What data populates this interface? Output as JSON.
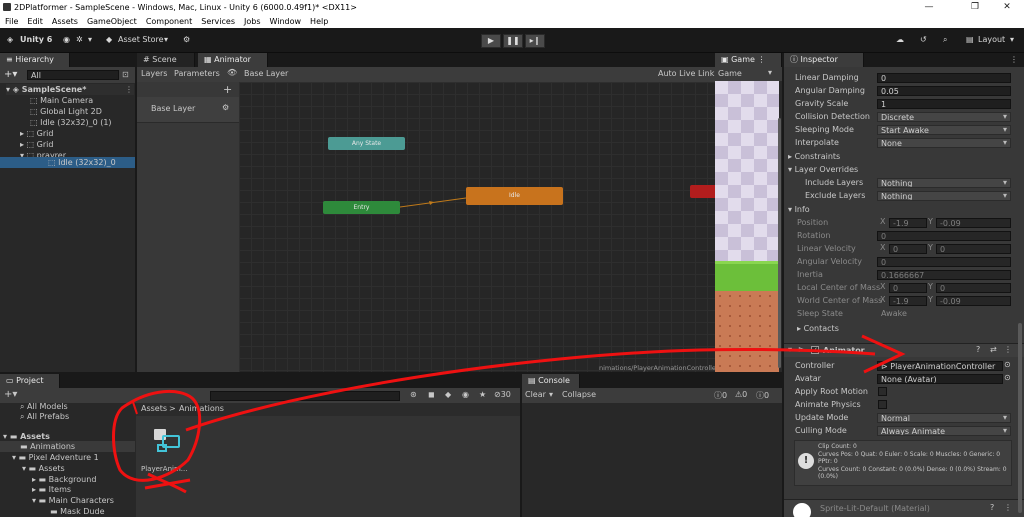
{
  "window": {
    "title": "2DPlatformer - SampleScene - Windows, Mac, Linux - Unity 6 (6000.0.49f1)* <DX11>",
    "minimize": "—",
    "maximize": "❐",
    "close": "✕"
  },
  "menu": [
    "File",
    "Edit",
    "Assets",
    "GameObject",
    "Component",
    "Services",
    "Jobs",
    "Window",
    "Help"
  ],
  "toolbar": {
    "unity_label": "Unity 6",
    "asset_store": "Asset Store",
    "layout": "Layout"
  },
  "hierarchy": {
    "tab": "Hierarchy",
    "search_placeholder": "All",
    "items": [
      {
        "label": "SampleScene*"
      },
      {
        "label": "Main Camera"
      },
      {
        "label": "Global Light 2D"
      },
      {
        "label": "Idle (32x32)_0 (1)"
      },
      {
        "label": "Grid"
      },
      {
        "label": "Grid"
      },
      {
        "label": "prayrer"
      },
      {
        "label": "Idle (32x32)_0"
      }
    ]
  },
  "animator": {
    "tabs": {
      "scene": "Scene",
      "animator": "Animator",
      "game": "Game"
    },
    "layers_tab": "Layers",
    "parameters_tab": "Parameters",
    "breadcrumb": "Base Layer",
    "auto_live_link": "Auto Live Link",
    "base_layer": "Base Layer",
    "nodes": {
      "any_state": "Any State",
      "entry": "Entry",
      "idle": "Idle"
    },
    "footer_path": "nimations/PlayerAnimationController.controller",
    "game_dropdown": "Game"
  },
  "inspector": {
    "tab": "Inspector",
    "rows": [
      {
        "label": "Linear Damping",
        "value": "0"
      },
      {
        "label": "Angular Damping",
        "value": "0.05"
      },
      {
        "label": "Gravity Scale",
        "value": "1"
      },
      {
        "label": "Collision Detection",
        "value": "Discrete"
      },
      {
        "label": "Sleeping Mode",
        "value": "Start Awake"
      },
      {
        "label": "Interpolate",
        "value": "None"
      }
    ],
    "constraints": "Constraints",
    "layer_overrides": "Layer Overrides",
    "include_layers": {
      "label": "Include Layers",
      "value": "Nothing"
    },
    "exclude_layers": {
      "label": "Exclude Layers",
      "value": "Nothing"
    },
    "info": "Info",
    "info_rows": {
      "position": {
        "label": "Position",
        "x": "-1.9",
        "y": "-0.09"
      },
      "rotation": {
        "label": "Rotation",
        "value": "0"
      },
      "linear_velocity": {
        "label": "Linear Velocity",
        "x": "0",
        "y": "0"
      },
      "angular_velocity": {
        "label": "Angular Velocity",
        "value": "0"
      },
      "inertia": {
        "label": "Inertia",
        "value": "0.1666667"
      },
      "local_com": {
        "label": "Local Center of Mass",
        "x": "0",
        "y": "0"
      },
      "world_com": {
        "label": "World Center of Mass",
        "x": "-1.9",
        "y": "-0.09"
      },
      "sleep_state": {
        "label": "Sleep State",
        "value": "Awake"
      }
    },
    "contacts": "Contacts",
    "animator_component": "Animator",
    "controller": {
      "label": "Controller",
      "value": "PlayerAnimationController"
    },
    "avatar": {
      "label": "Avatar",
      "value": "None (Avatar)"
    },
    "apply_root_motion": "Apply Root Motion",
    "animate_physics": "Animate Physics",
    "update_mode": {
      "label": "Update Mode",
      "value": "Normal"
    },
    "culling_mode": {
      "label": "Culling Mode",
      "value": "Always Animate"
    },
    "info_box": "Clip Count: 0\nCurves Pos: 0 Quat: 0 Euler: 0 Scale: 0 Muscles: 0 Generic: 0 PPtr: 0\nCurves Count: 0 Constant: 0 (0.0%) Dense: 0 (0.0%) Stream: 0 (0.0%)",
    "material": "Sprite-Lit-Default (Material)",
    "x_label": "X",
    "y_label": "Y"
  },
  "project": {
    "tab": "Project",
    "count": "30",
    "breadcrumb_root": "Assets",
    "breadcrumb_sep": ">",
    "breadcrumb_child": "Animations",
    "tree": [
      {
        "label": "All Models"
      },
      {
        "label": "All Prefabs"
      },
      {
        "label": "Assets"
      },
      {
        "label": "Animations"
      },
      {
        "label": "Pixel Adventure 1"
      },
      {
        "label": "Assets"
      },
      {
        "label": "Background"
      },
      {
        "label": "Items"
      },
      {
        "label": "Main Characters"
      },
      {
        "label": "Mask Dude"
      }
    ],
    "asset_label": "PlayerAnim..."
  },
  "console": {
    "tab": "Console",
    "clear": "Clear",
    "collapse": "Collapse",
    "counts": [
      "0",
      "0",
      "0"
    ]
  }
}
